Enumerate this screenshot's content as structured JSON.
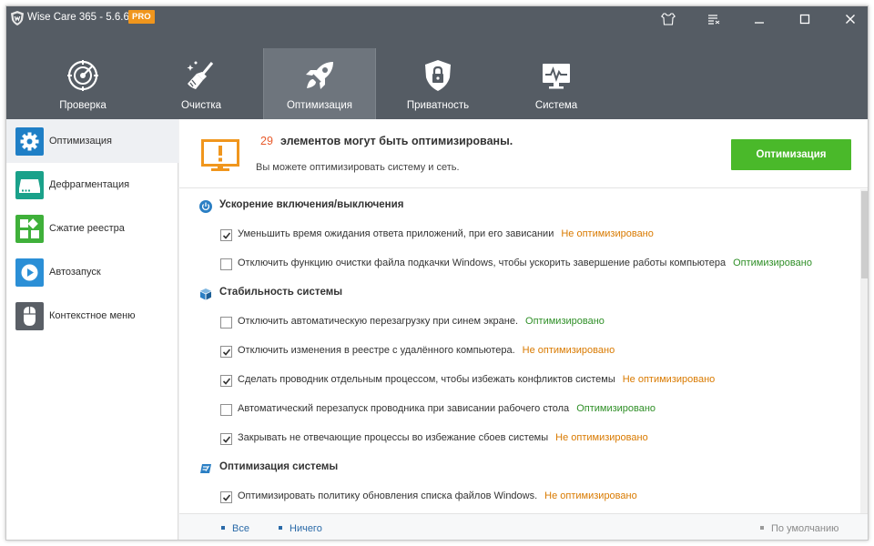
{
  "app": {
    "title": "Wise Care 365 - 5.6.6",
    "badge": "PRO"
  },
  "titlebar": {
    "buttons": [
      {
        "name": "skin-icon"
      },
      {
        "name": "menu-icon"
      },
      {
        "name": "minimize-icon"
      },
      {
        "name": "maximize-icon"
      },
      {
        "name": "close-icon"
      }
    ]
  },
  "nav": {
    "tabs": [
      {
        "label": "Проверка",
        "icon": "radar-icon"
      },
      {
        "label": "Очистка",
        "icon": "broom-icon"
      },
      {
        "label": "Оптимизация",
        "icon": "rocket-icon",
        "active": true
      },
      {
        "label": "Приватность",
        "icon": "lock-shield-icon"
      },
      {
        "label": "Система",
        "icon": "monitor-icon"
      }
    ]
  },
  "sidebar": {
    "items": [
      {
        "label": "Оптимизация",
        "icon": "gear-icon",
        "color": "#1f7fc6",
        "active": true
      },
      {
        "label": "Дефрагментация",
        "icon": "disk-icon",
        "color": "#1aa18a"
      },
      {
        "label": "Сжатие реестра",
        "icon": "registry-icon",
        "color": "#3fb03a"
      },
      {
        "label": "Автозапуск",
        "icon": "play-icon",
        "color": "#2b8fd6"
      },
      {
        "label": "Контекстное меню",
        "icon": "mouse-icon",
        "color": "#5a5f66"
      }
    ]
  },
  "banner": {
    "count": "29",
    "title": "элементов могут быть оптимизированы.",
    "subtitle": "Вы можете оптимизировать систему и сеть.",
    "button": "Оптимизация"
  },
  "sections": [
    {
      "title": "Ускорение включения/выключения",
      "icon": "power-icon",
      "items": [
        {
          "text": "Уменьшить время ожидания ответа приложений, при его зависании",
          "checked": true,
          "status": "Не оптимизировано"
        },
        {
          "text": "Отключить функцию очистки файла подкачки Windows, чтобы ускорить завершение работы компьютера",
          "checked": false,
          "status": "Оптимизировано"
        }
      ]
    },
    {
      "title": "Стабильность системы",
      "icon": "cube-icon",
      "items": [
        {
          "text": "Отключить автоматическую перезагрузку при синем экране.",
          "checked": false,
          "status": "Оптимизировано"
        },
        {
          "text": "Отключить изменения в реестре с удалённого компьютера.",
          "checked": true,
          "status": "Не оптимизировано"
        },
        {
          "text": "Сделать проводник отдельным процессом, чтобы избежать конфликтов системы",
          "checked": true,
          "status": "Не оптимизировано"
        },
        {
          "text": "Автоматический перезапуск проводника при зависании рабочего стола",
          "checked": false,
          "status": "Оптимизировано"
        },
        {
          "text": "Закрывать не отвечающие процессы во избежание сбоев системы",
          "checked": true,
          "status": "Не оптимизировано"
        }
      ]
    },
    {
      "title": "Оптимизация системы",
      "icon": "speed-icon",
      "items": [
        {
          "text": "Оптимизировать политику обновления списка файлов Windows.",
          "checked": true,
          "status": "Не оптимизировано"
        }
      ]
    }
  ],
  "footer": {
    "all": "Все",
    "none": "Ничего",
    "default": "По умолчанию"
  },
  "colors": {
    "header_bg": "#555c64",
    "accent_green": "#4ab92a",
    "warn": "#d97a00",
    "ok": "#2f8f27",
    "banner_icon": "#f0961d"
  }
}
